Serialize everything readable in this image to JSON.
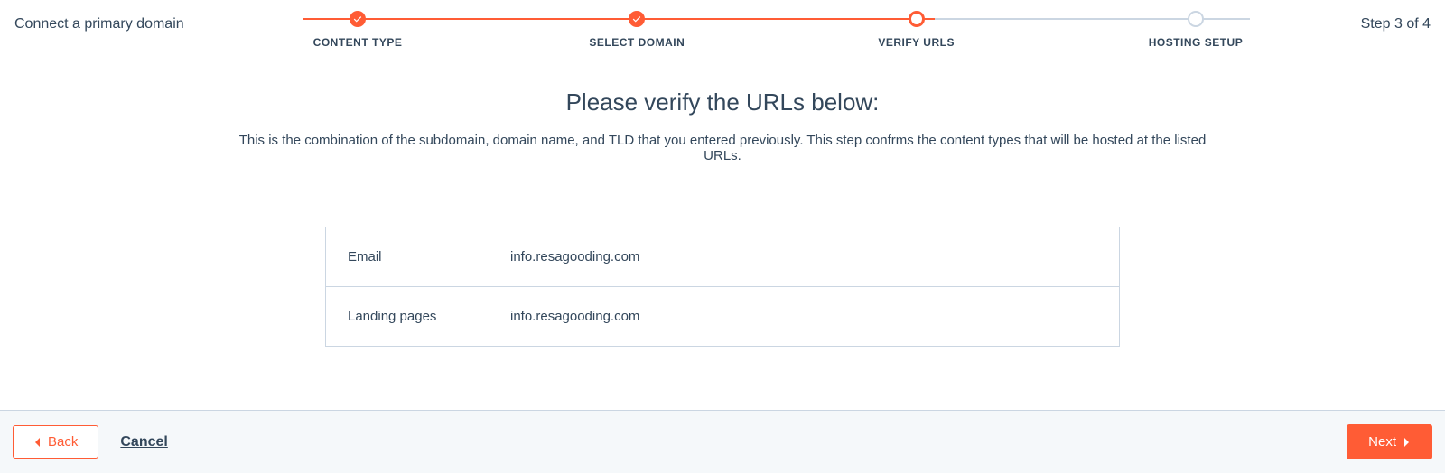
{
  "header": {
    "title": "Connect a primary domain",
    "step_indicator": "Step 3 of 4"
  },
  "stepper": {
    "items": [
      {
        "label": "CONTENT TYPE",
        "state": "done"
      },
      {
        "label": "SELECT DOMAIN",
        "state": "done"
      },
      {
        "label": "VERIFY URLS",
        "state": "active"
      },
      {
        "label": "HOSTING SETUP",
        "state": "todo"
      }
    ]
  },
  "main": {
    "heading": "Please verify the URLs below:",
    "subtext": "This is the combination of the subdomain, domain name, and TLD that you entered previously. This step confrms the content types that will be hosted at the listed URLs."
  },
  "url_rows": [
    {
      "label": "Email",
      "value": "info.resagooding.com"
    },
    {
      "label": "Landing pages",
      "value": "info.resagooding.com"
    }
  ],
  "footer": {
    "back_label": "Back",
    "cancel_label": "Cancel",
    "next_label": "Next"
  }
}
